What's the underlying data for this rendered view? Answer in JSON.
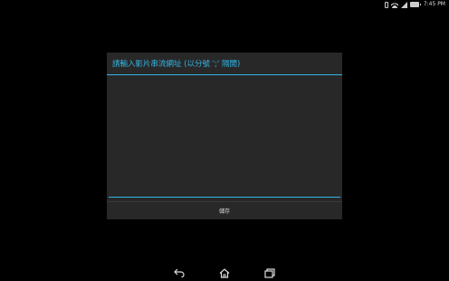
{
  "status_bar": {
    "time": "7:45 PM",
    "icons": [
      "vibrate-icon",
      "wifi-icon",
      "signal-icon",
      "battery-icon"
    ]
  },
  "dialog": {
    "title": "請輸入影片串流網址 (以分號 ';' 隔開)",
    "input_value": "",
    "save_label": "儲存"
  },
  "nav_bar": {
    "icons": [
      "back-icon",
      "home-icon",
      "recent-apps-icon"
    ]
  },
  "colors": {
    "accent": "#33b5e5",
    "background": "#000000",
    "dialog_bg": "#282828"
  }
}
